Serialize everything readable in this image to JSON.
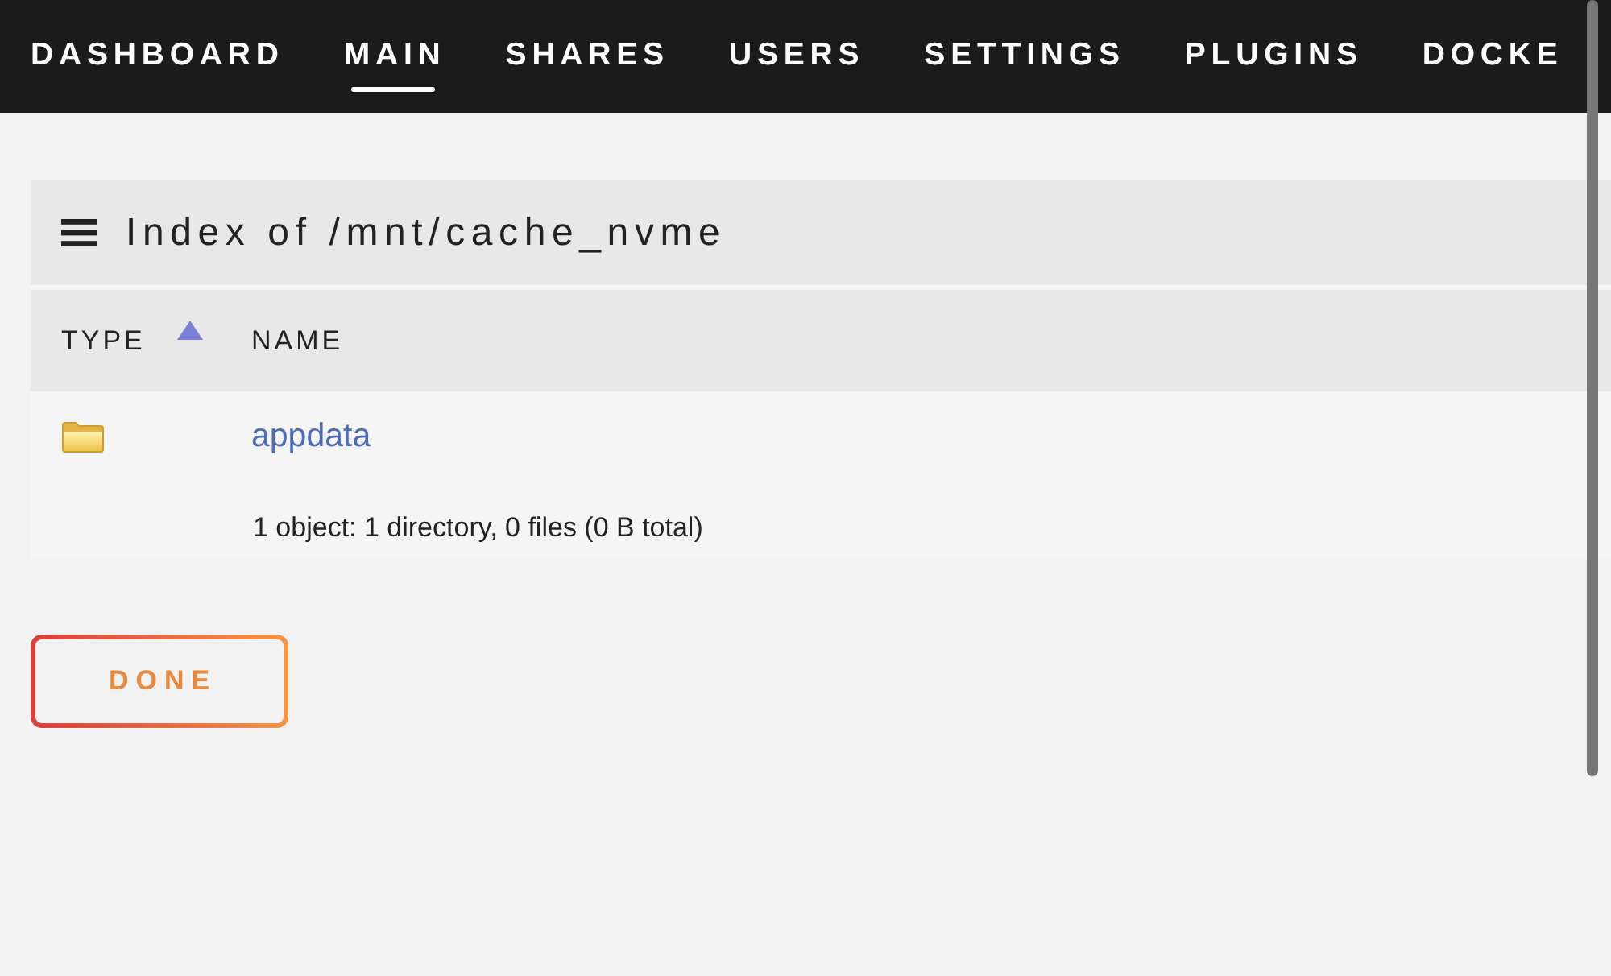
{
  "nav": {
    "tabs": [
      {
        "label": "DASHBOARD",
        "selected": false
      },
      {
        "label": "MAIN",
        "selected": true
      },
      {
        "label": "SHARES",
        "selected": false
      },
      {
        "label": "USERS",
        "selected": false
      },
      {
        "label": "SETTINGS",
        "selected": false
      },
      {
        "label": "PLUGINS",
        "selected": false
      },
      {
        "label": "DOCKE",
        "selected": false
      }
    ]
  },
  "panel": {
    "title": "Index of /mnt/cache_nvme",
    "table": {
      "columns": [
        {
          "label": "TYPE",
          "sorted_ascending": true
        },
        {
          "label": "NAME",
          "sorted_ascending": false
        }
      ],
      "rows": [
        {
          "kind": "folder",
          "name": "appdata"
        }
      ],
      "summary": "1 object: 1 directory, 0 files (0 B total)"
    }
  },
  "buttons": [
    {
      "label": "DONE"
    }
  ]
}
